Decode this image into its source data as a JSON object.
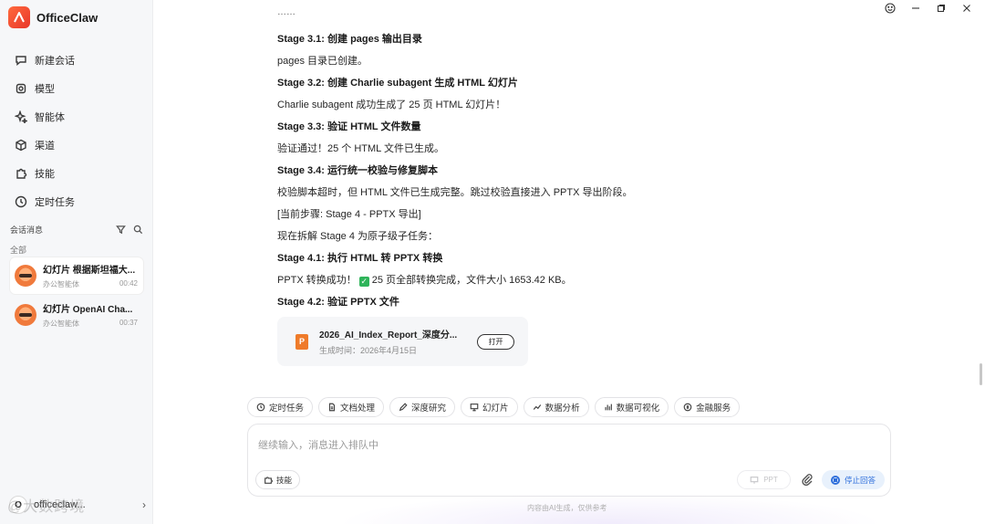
{
  "app": {
    "name": "OfficeClaw"
  },
  "nav": [
    {
      "label": "新建会话",
      "icon": "chat-bubble-icon"
    },
    {
      "label": "模型",
      "icon": "model-cube-icon"
    },
    {
      "label": "智能体",
      "icon": "sparkle-icon"
    },
    {
      "label": "渠道",
      "icon": "box-icon"
    },
    {
      "label": "技能",
      "icon": "puzzle-icon"
    },
    {
      "label": "定时任务",
      "icon": "clock-icon"
    }
  ],
  "sessions_header": {
    "title": "会话消息",
    "group": "全部"
  },
  "sessions": [
    {
      "title": "幻灯片 根据斯坦福大...",
      "agent": "办公智能体",
      "time": "00:42"
    },
    {
      "title": "幻灯片 OpenAI Cha...",
      "agent": "办公智能体",
      "time": "00:37"
    }
  ],
  "user": {
    "initial": "O",
    "name": "officeclaw..."
  },
  "watermark": "@大数跨境",
  "messages": [
    {
      "text": "Stage 3.1: 创建 pages 输出目录",
      "bold": true
    },
    {
      "text": "pages 目录已创建。",
      "bold": false
    },
    {
      "text": "Stage 3.2: 创建 Charlie subagent 生成 HTML 幻灯片",
      "bold": true
    },
    {
      "text": "Charlie subagent 成功生成了 25 页 HTML 幻灯片！",
      "bold": false
    },
    {
      "text": "Stage 3.3: 验证 HTML 文件数量",
      "bold": true
    },
    {
      "text": "验证通过！25 个 HTML 文件已生成。",
      "bold": false
    },
    {
      "text": "Stage 3.4: 运行统一校验与修复脚本",
      "bold": true
    },
    {
      "text": "校验脚本超时，但 HTML 文件已生成完整。跳过校验直接进入 PPTX 导出阶段。",
      "bold": false
    },
    {
      "text": "[当前步骤: Stage 4 - PPTX 导出]",
      "bold": false
    },
    {
      "text": "现在拆解 Stage 4 为原子级子任务：",
      "bold": false
    },
    {
      "text": "Stage 4.1: 执行 HTML 转 PPTX 转换",
      "bold": true
    },
    {
      "text_before": "PPTX 转换成功！",
      "text_after": "25 页全部转换完成，文件大小 1653.42 KB。",
      "bold": false,
      "check": true
    },
    {
      "text": "Stage 4.2: 验证 PPTX 文件",
      "bold": true
    }
  ],
  "file_card": {
    "icon_letter": "P",
    "name": "2026_AI_Index_Report_深度分...",
    "time": "生成时间：2026年4月15日",
    "open_label": "打开"
  },
  "chips": [
    {
      "label": "定时任务",
      "icon": "clock-icon"
    },
    {
      "label": "文档处理",
      "icon": "document-icon"
    },
    {
      "label": "深度研究",
      "icon": "pen-icon"
    },
    {
      "label": "幻灯片",
      "icon": "slides-icon"
    },
    {
      "label": "数据分析",
      "icon": "trend-icon"
    },
    {
      "label": "数据可视化",
      "icon": "bar-chart-icon"
    },
    {
      "label": "金融服务",
      "icon": "coin-icon"
    }
  ],
  "composer": {
    "placeholder": "继续输入，消息进入排队中",
    "skill_label": "技能",
    "ppt_label": "PPT",
    "stop_label": "停止回答"
  },
  "footer_note": "内容由AI生成，仅供参考"
}
